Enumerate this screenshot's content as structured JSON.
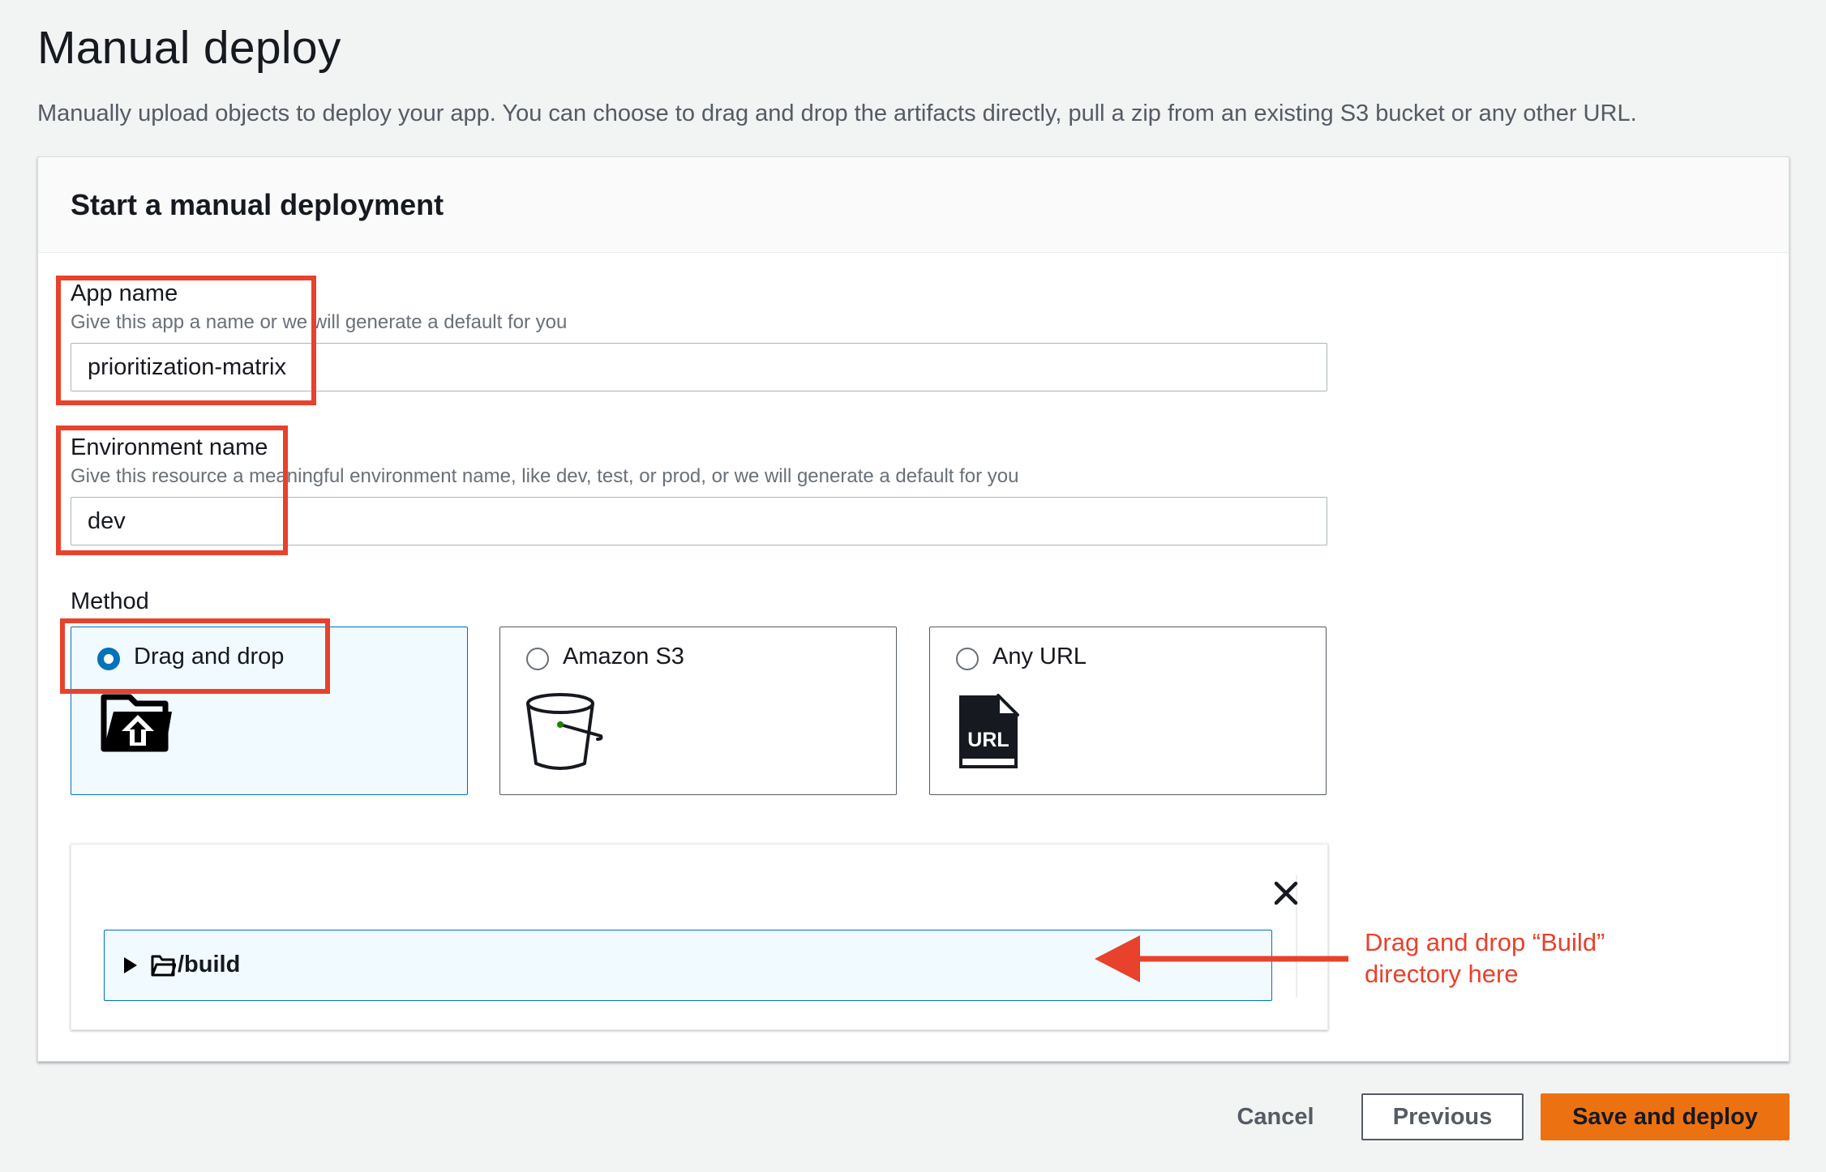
{
  "page": {
    "title": "Manual deploy",
    "description": "Manually upload objects to deploy your app. You can choose to drag and drop the artifacts directly, pull a zip from an existing S3 bucket or any other URL."
  },
  "form": {
    "header": "Start a manual deployment",
    "app_name": {
      "label": "App name",
      "description": "Give this app a name or we will generate a default for you",
      "value": "prioritization-matrix"
    },
    "environment_name": {
      "label": "Environment name",
      "description": "Give this resource a meaningful environment name, like dev, test, or prod, or we will generate a default for you",
      "value": "dev"
    },
    "method": {
      "label": "Method",
      "options": [
        {
          "label": "Drag and drop",
          "selected": true,
          "icon": "folder-upload-icon"
        },
        {
          "label": "Amazon S3",
          "selected": false,
          "icon": "bucket-icon"
        },
        {
          "label": "Any URL",
          "selected": false,
          "icon": "url-file-icon"
        }
      ]
    },
    "upload": {
      "folder": "/build"
    }
  },
  "annotation": {
    "text_line1": "Drag and drop “Build”",
    "text_line2": "directory here",
    "color": "#e8412c"
  },
  "footer": {
    "cancel": "Cancel",
    "previous": "Previous",
    "primary": "Save and deploy"
  },
  "colors": {
    "accent": "#0073bb",
    "primary_button": "#ec7211",
    "highlight": "#e8412c"
  }
}
